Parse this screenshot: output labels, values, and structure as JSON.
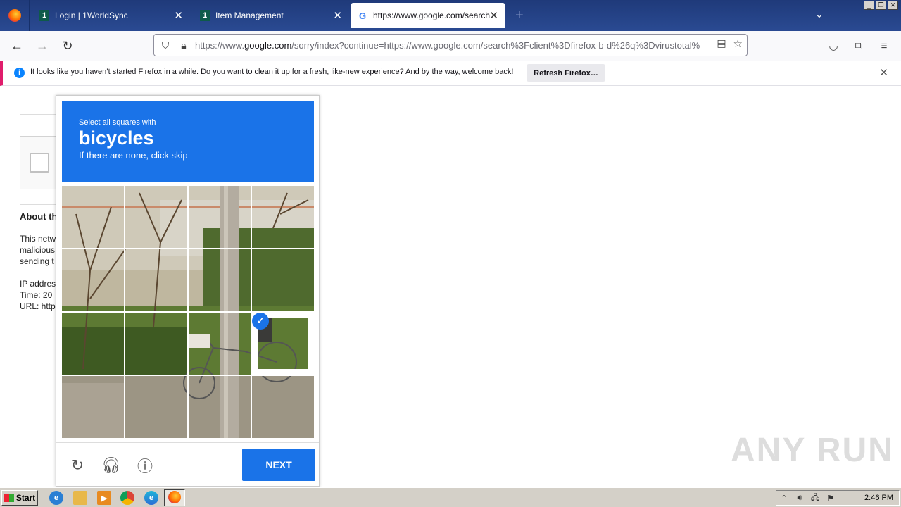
{
  "browser": {
    "tabs": [
      {
        "label": "Login | 1WorldSync",
        "favicon": "1"
      },
      {
        "label": "Item Management",
        "favicon": "1"
      },
      {
        "label": "https://www.google.com/search?c",
        "favicon": "G",
        "active": true
      }
    ],
    "new_tab_label": "+",
    "url_prefix": "https://www.",
    "url_domain": "google.com",
    "url_rest": "/sorry/index?continue=https://www.google.com/search%3Fclient%3Dfirefox-b-d%26q%3Dvirustotal%"
  },
  "notification": {
    "text": "It looks like you haven’t started Firefox in a while. Do you want to clean it up for a fresh, like-new experience? And by the way, welcome back!",
    "button": "Refresh Firefox…"
  },
  "page": {
    "about_heading": "About th",
    "lines": [
      "This netw",
      "malicious",
      "sending t",
      "IP addres",
      "Time: 20",
      "URL: http"
    ]
  },
  "captcha": {
    "instruction_small": "Select all squares with",
    "target": "bicycles",
    "instruction_sub": "If there are none, click skip",
    "next_label": "NEXT",
    "selected_tile": 11,
    "accent_color": "#1a73e8"
  },
  "watermark": "ANY RUN",
  "taskbar": {
    "start_label": "Start",
    "clock": "2:46 PM"
  }
}
